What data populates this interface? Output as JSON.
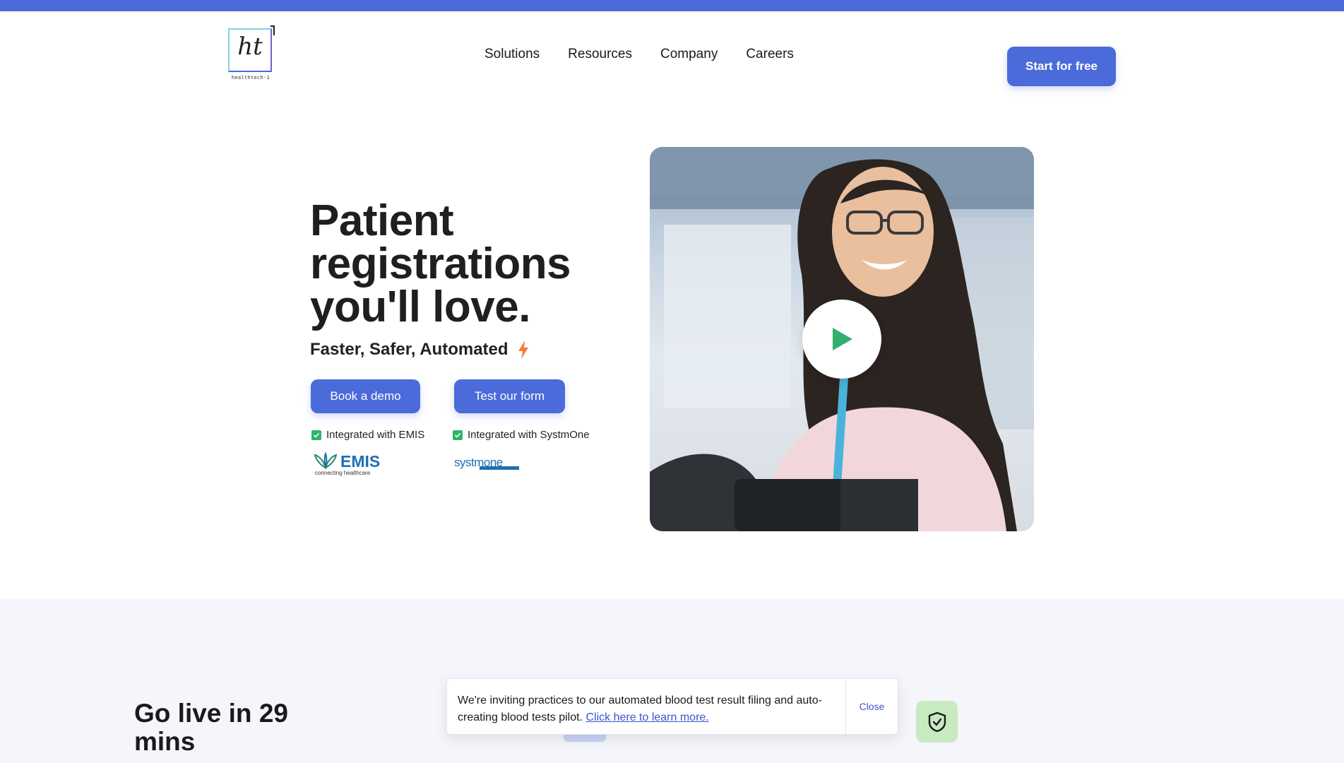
{
  "brand": {
    "logo_mark": "ht",
    "logo_sub": "healthtech-1"
  },
  "nav": {
    "items": [
      "Solutions",
      "Resources",
      "Company",
      "Careers"
    ]
  },
  "header": {
    "cta_label": "Start for free"
  },
  "hero": {
    "title": "Patient registrations you'll love.",
    "subtitle": "Faster, Safer, Automated",
    "buttons": {
      "demo": "Book a demo",
      "test": "Test our form"
    },
    "integrations": [
      {
        "label": "Integrated with EMIS"
      },
      {
        "label": "Integrated with SystmOne"
      }
    ],
    "logos": {
      "emis": {
        "name": "EMIS",
        "tagline": "connecting healthcare"
      },
      "systmone": {
        "name": "systmone"
      }
    },
    "image_icon": "person-photo",
    "play_icon": "play-icon"
  },
  "section2": {
    "heading": "Go live in 29 mins"
  },
  "toast": {
    "message": "We're inviting practices to our automated blood test result filing and auto-creating blood tests pilot.",
    "link": "Click here to learn more.",
    "close_label": "Close"
  },
  "colors": {
    "accent": "#4a6bd9",
    "check_green": "#2fb36a",
    "shield_bg": "#c8eac0",
    "bolt": "#f27d3a"
  }
}
